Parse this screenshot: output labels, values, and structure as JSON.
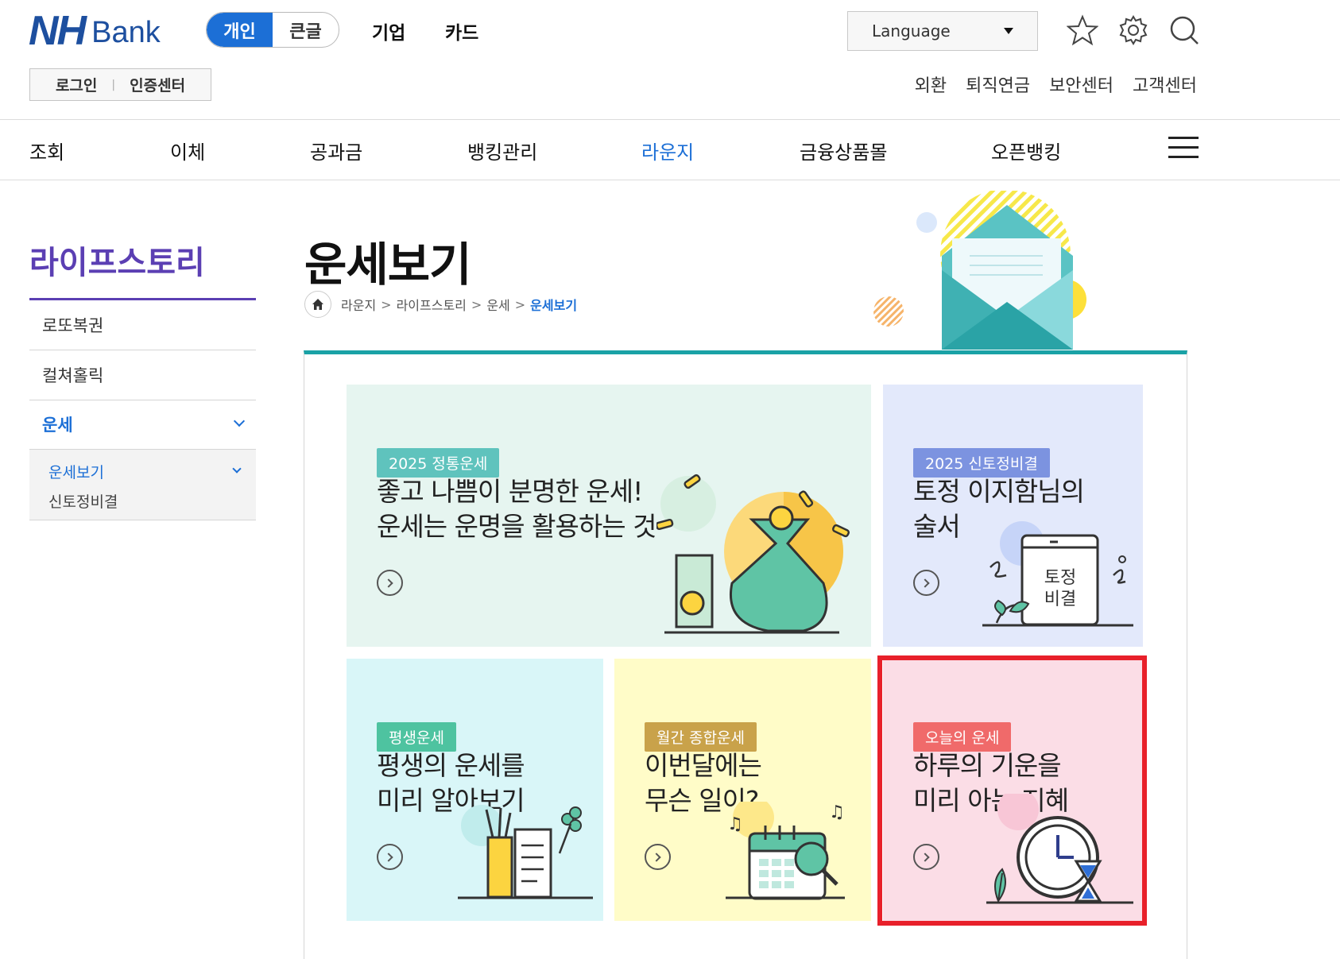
{
  "header": {
    "logo_nh": "NH",
    "logo_bank": "Bank",
    "segment": {
      "personal": "개인",
      "large": "큰글"
    },
    "top_nav": [
      "기업",
      "카드"
    ],
    "language_label": "Language",
    "login": "로그인",
    "cert": "인증센터",
    "util_nav": [
      "외환",
      "퇴직연금",
      "보안센터",
      "고객센터"
    ]
  },
  "gnb": [
    "조회",
    "이체",
    "공과금",
    "뱅킹관리",
    "라운지",
    "금융상품몰",
    "오픈뱅킹"
  ],
  "gnb_active_index": 4,
  "sidebar": {
    "title": "라이프스토리",
    "items": [
      "로또복권",
      "컬쳐홀릭",
      "운세"
    ],
    "sub_items": [
      "운세보기",
      "신토정비결"
    ]
  },
  "main": {
    "title": "운세보기",
    "breadcrumb": [
      "라운지",
      "라이프스토리",
      "운세",
      "운세보기"
    ]
  },
  "cards": [
    {
      "tag": "2025 정통운세",
      "line1": "좋고 나쁨이 분명한 운세!",
      "line2": "운세는 운명을 활용하는 것",
      "bg": "#e6f5f0",
      "tag_color": "#5fc3bd"
    },
    {
      "tag": "2025 신토정비결",
      "line1": "토정 이지함님의",
      "line2": "술서",
      "bg": "#e3e9fb",
      "tag_color": "#7c93e0",
      "book_text_1": "토정",
      "book_text_2": "비결"
    },
    {
      "tag": "평생운세",
      "line1": "평생의 운세를",
      "line2": "미리 알아보기",
      "bg": "#d9f6f8",
      "tag_color": "#4ec3a0"
    },
    {
      "tag": "월간 종합운세",
      "line1": "이번달에는",
      "line2": "무슨 일이?",
      "bg": "#fffcc8",
      "tag_color": "#c9a24a"
    },
    {
      "tag": "오늘의 운세",
      "line1": "하루의 기운을",
      "line2": "미리 아는 지혜",
      "bg": "#fbdde6",
      "tag_color": "#f06a6a"
    }
  ],
  "colors": {
    "brand": "#1d4f9f",
    "accent": "#1c6fd6",
    "sidebar_accent": "#5b3fb3",
    "panel_top": "#1aa2a6",
    "highlight": "#e8202a"
  }
}
